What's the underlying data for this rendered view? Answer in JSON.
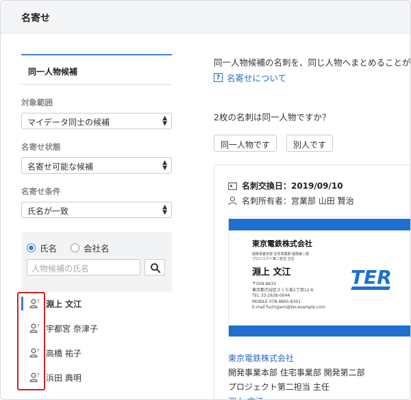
{
  "header": {
    "title": "名寄せ"
  },
  "sidebar": {
    "tab": "同一人物候補",
    "scope_label": "対象範囲",
    "scope_value": "マイデータ同士の候補",
    "status_label": "名寄せ状態",
    "status_value": "名寄せ可能な候補",
    "condition_label": "名寄せ条件",
    "condition_value": "氏名が一致",
    "radio_name": "氏名",
    "radio_company": "会社名",
    "search_placeholder": "人物候補の氏名",
    "candidates": [
      "淵上 文江",
      "宇都宮 奈津子",
      "高橋 祐子",
      "浜田 典明"
    ]
  },
  "main": {
    "intro": "同一人物候補の名刺を、同じ人物へまとめることがで",
    "help_link": "名寄せについて",
    "question": "2枚の名刺は同一人物ですか？",
    "btn_same": "同一人物です",
    "btn_diff": "別人です",
    "exchange_date": "名刺交換日：2019/09/10",
    "owner": "名刺所有者：営業部 山田 賢治",
    "card": {
      "company": "東京電鉄株式会社",
      "dept_line1": "開発事業本部 住宅事業部 開発第二部",
      "dept_line2": "プロジェクト第二担当 主任",
      "name": "淵上 文江",
      "zip": "〒009-8833",
      "address": "東京都渋谷区さくら坂1丁目12-6",
      "tel": "TEL 33-2638-0044",
      "mobile": "MOBILE 078-9865-8301",
      "email": "E-mail fuchigami@ter.example.com",
      "logo_text": "TER",
      "logo_color": "#1e6fd0"
    },
    "details": {
      "company": "東京電鉄株式会社",
      "dept1": "開発事業本部 住宅事業部 開発第二部",
      "dept2": "プロジェクト第二担当 主任",
      "name": "淵上 文江"
    }
  },
  "colors": {
    "accent": "#3c7fd4",
    "link": "#2a6bc1",
    "highlight": "#cc1f1f"
  }
}
